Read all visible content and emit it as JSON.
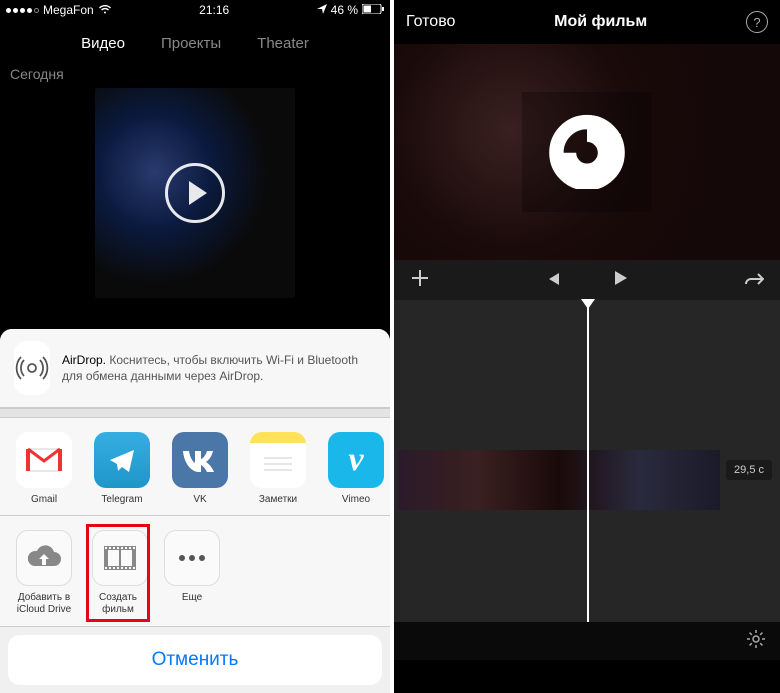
{
  "left": {
    "status": {
      "carrier": "MegaFon",
      "time": "21:16",
      "battery": "46 %"
    },
    "tabs": {
      "video": "Видео",
      "projects": "Проекты",
      "theater": "Theater"
    },
    "section": "Сегодня",
    "airdrop": {
      "title": "AirDrop.",
      "body": "Коснитесь, чтобы включить Wi-Fi и Bluetooth для обмена данными через AirDrop."
    },
    "apps": {
      "gmail": "Gmail",
      "telegram": "Telegram",
      "vk": "VK",
      "notes": "Заметки",
      "vimeo": "Vimeo"
    },
    "actions": {
      "icloud": "Добавить в iCloud Drive",
      "movie": "Создать фильм",
      "more": "Еще"
    },
    "cancel": "Отменить"
  },
  "right": {
    "done": "Готово",
    "title": "Мой фильм",
    "timecode": "29,5 c"
  }
}
